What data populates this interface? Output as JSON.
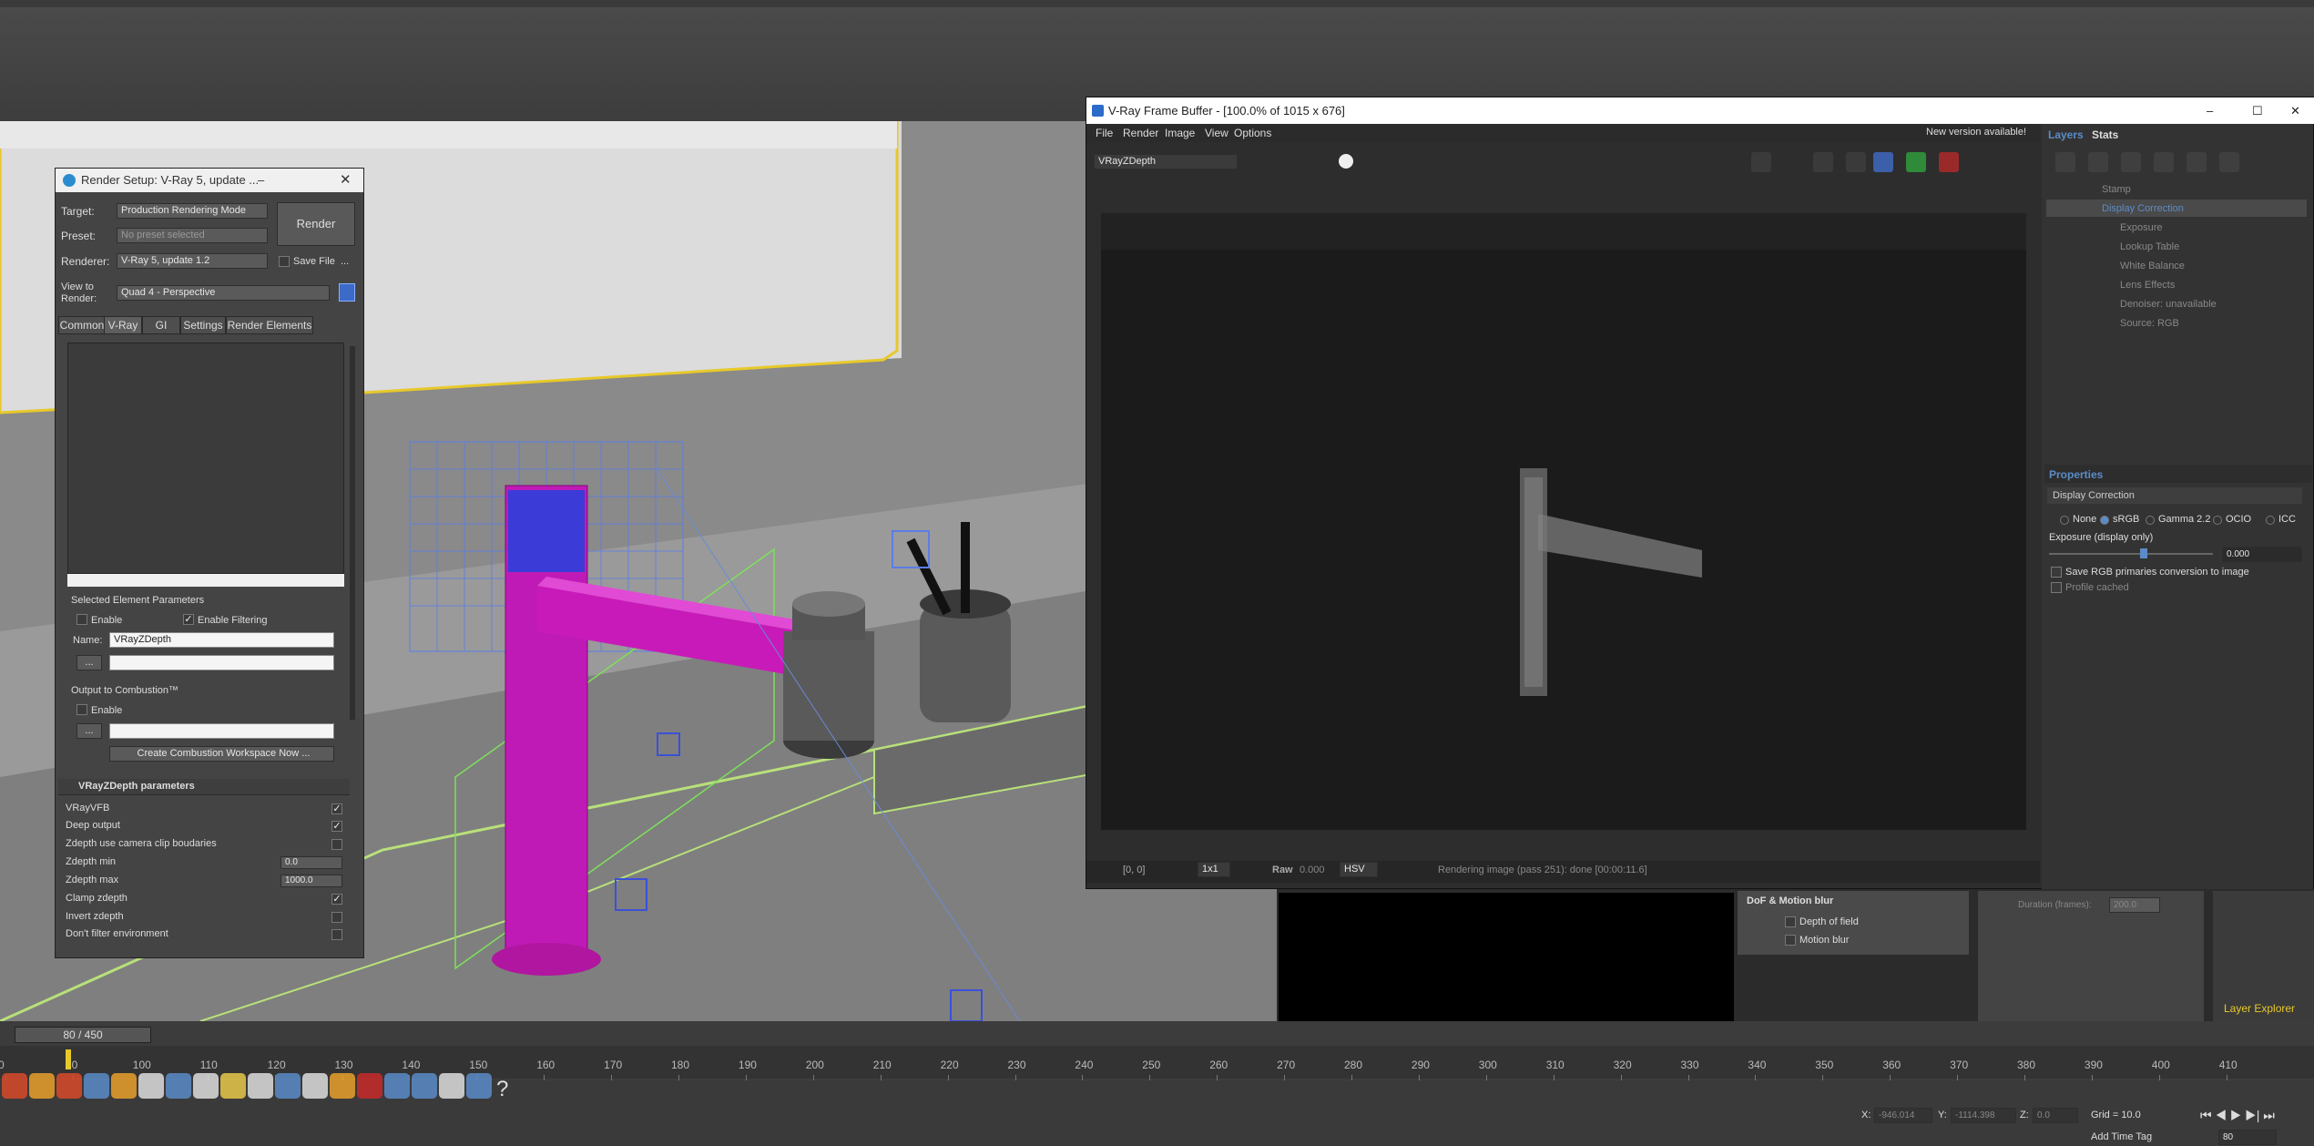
{
  "render_setup": {
    "title": "Render Setup: V-Ray 5, update ...",
    "target_label": "Target:",
    "target_value": "Production Rendering Mode",
    "preset_label": "Preset:",
    "preset_value": "No preset selected",
    "renderer_label": "Renderer:",
    "renderer_value": "V-Ray 5, update 1.2",
    "save_file": "Save File",
    "view_label": "View to Render:",
    "view_value": "Quad 4 - Perspective",
    "render_button": "Render",
    "tabs": [
      "Common",
      "V-Ray",
      "GI",
      "Settings",
      "Render Elements"
    ],
    "selected_params_header": "Selected Element Parameters",
    "enable": "Enable",
    "enable_filtering": "Enable Filtering",
    "name_label": "Name:",
    "name_value": "VRayZDepth",
    "output_header": "Output to Combustion™",
    "enable2": "Enable",
    "create_combustion": "Create Combustion Workspace Now ...",
    "rollout_title": "VRayZDepth parameters",
    "params": [
      {
        "label": "VRayVFB",
        "checked": true
      },
      {
        "label": "Deep output",
        "checked": true
      },
      {
        "label": "Zdepth use camera clip boudaries",
        "checked": false
      },
      {
        "label": "Zdepth min",
        "value": "0.0"
      },
      {
        "label": "Zdepth max",
        "value": "1000.0"
      },
      {
        "label": "Clamp zdepth",
        "checked": true
      },
      {
        "label": "Invert zdepth",
        "checked": false
      },
      {
        "label": "Don't filter environment",
        "checked": false
      }
    ],
    "dots": "..."
  },
  "vfb": {
    "title": "V-Ray Frame Buffer - [100.0% of 1015 x 676]",
    "menu": [
      "File",
      "Render",
      "Image",
      "View",
      "Options"
    ],
    "channel": "VRayZDepth",
    "new_version": "New version available!",
    "coords": "[0, 0]",
    "zoom": "1x1",
    "raw_label": "Raw",
    "raw_value": "0.000",
    "color_mode": "HSV",
    "status": "Rendering image (pass 251): done [00:00:11.6]",
    "layers_tab": "Layers",
    "stats_tab": "Stats",
    "layers": [
      "Stamp",
      "Display Correction",
      "Exposure",
      "Lookup Table",
      "White Balance",
      "Lens Effects",
      "Denoiser: unavailable",
      "Source: RGB"
    ],
    "properties_title": "Properties",
    "properties_name": "Display Correction",
    "color_options": [
      "None",
      "sRGB",
      "Gamma 2.2",
      "OCIO",
      "ICC"
    ],
    "exposure_label": "Exposure (display only)",
    "exposure_value": "0.000",
    "save_rgb": "Save RGB primaries conversion to image",
    "profile_cached": "Profile cached"
  },
  "side_panels": {
    "dof_title": "DoF & Motion blur",
    "depth_of_field": "Depth of field",
    "motion_blur": "Motion blur",
    "duration_label": "Duration (frames):",
    "duration_value": "200.0",
    "layer_explorer": "Layer Explorer"
  },
  "timeline": {
    "slider": "80 / 450",
    "ticks": [
      "0",
      "90",
      "100",
      "110",
      "120",
      "130",
      "140",
      "150",
      "160",
      "170",
      "180",
      "190",
      "200",
      "210",
      "220",
      "230",
      "240",
      "250",
      "260",
      "270",
      "280",
      "290",
      "300",
      "310",
      "320",
      "330",
      "340",
      "350",
      "360",
      "370",
      "380",
      "390",
      "400",
      "410"
    ]
  },
  "status_bar": {
    "x_label": "X:",
    "x_value": "-946.014",
    "y_label": "Y:",
    "y_value": "-1114.398",
    "z_label": "Z:",
    "z_value": "0.0",
    "grid": "Grid = 10.0",
    "add_time_tag": "Add Time Tag",
    "frame": "80"
  },
  "colors": {
    "accent": "#5b8cc8",
    "magenta": "#c01ab6",
    "wire_green": "#b8e07a",
    "blue_wire": "#5a7de8"
  }
}
